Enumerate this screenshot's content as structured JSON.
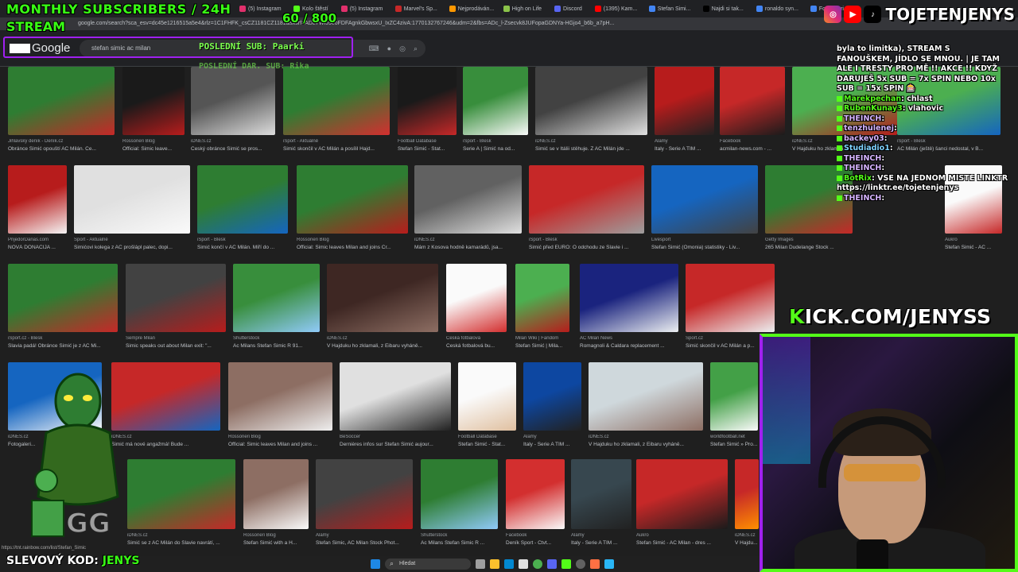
{
  "browser": {
    "tabs": [
      {
        "label": "(5) Instagram",
        "color": "#e1306c"
      },
      {
        "label": "Kolo štěstí",
        "color": "#53fc18"
      },
      {
        "label": "(5) Instagram",
        "color": "#e1306c"
      },
      {
        "label": "Marvel's Sp...",
        "color": "#c62828"
      },
      {
        "label": "Nejprodáván...",
        "color": "#ff9800"
      },
      {
        "label": "High on Life",
        "color": "#8bc34a"
      },
      {
        "label": "Discord",
        "color": "#5865f2"
      },
      {
        "label": "(1395) Kam...",
        "color": "#ff0000"
      },
      {
        "label": "Stefan Simi...",
        "color": "#4285f4"
      },
      {
        "label": "Najdi si tak...",
        "color": "#000000"
      },
      {
        "label": "ronaldo syn...",
        "color": "#4285f4"
      },
      {
        "label": "Fotogaleri...",
        "color": "#4285f4"
      }
    ],
    "url": "google.com/search?sca_esv=dc45e1216515a5e4&rlz=1C1FHFK_csCZ1181CZ1181&sxsrf=ADLYWIJ9eoFDFAgnkGbwsxU_IxZC4zivA:1770132767246&udm=2&fbs=ADc_l-Zsecvk8JUFopaGDNYa-HGjo4_b6b_a7pH..."
  },
  "google": {
    "logo": "Google",
    "query": "stefan simic ac milan"
  },
  "overlay": {
    "title_line1": "MONTHLY SUBSCRIBERS / 24H",
    "title_line2": "STREAM",
    "sub_count": "60  / 800",
    "last_sub": "POSLEDNÍ SUB: Paarki",
    "last_donation": "POSLEDNÍ DAR. SUB: Rika",
    "social_name": "TOJETENJENYS",
    "kick_k": "K",
    "kick_rest": "ICK.COM/JENYSS",
    "discount_label": "SLEVOVÝ KOD: ",
    "discount_code": "JENYS"
  },
  "chat": [
    {
      "kind": "text",
      "text": "byla to limitka), STREAM S FANOUŠKEM, JÍDLO SE MNOU. | JE TAM ALE I TRESTY PRO MĚ !! AKCE !! KDYŽ DARUJEŠ 5x SUB = 7x SPIN NEBO 10x SUB = 15x SPIN 🎰"
    },
    {
      "kind": "msg",
      "user": "Marekpechan",
      "text": ": chlast",
      "ucls": "u"
    },
    {
      "kind": "msg",
      "user": "RubenKunay3",
      "text": ": vlahovic",
      "ucls": "u"
    },
    {
      "kind": "msg",
      "user": "THEINCH",
      "text": ":",
      "ucls": "u2"
    },
    {
      "kind": "msg",
      "user": "tenzhulenej",
      "text": ":",
      "ucls": "u2"
    },
    {
      "kind": "msg",
      "user": "backey03",
      "text": ":",
      "ucls": "u2"
    },
    {
      "kind": "msg",
      "user": "Studiadio1",
      "text": ":",
      "ucls": "u3"
    },
    {
      "kind": "msg",
      "user": "THEINCH",
      "text": ":",
      "ucls": "u2"
    },
    {
      "kind": "msg",
      "user": "THEINCH",
      "text": ":",
      "ucls": "u2"
    },
    {
      "kind": "msg",
      "user": "BotRix",
      "text": ": VŠE NA JEDNOM MÍSTĚ LINKTREE:",
      "ucls": "u"
    },
    {
      "kind": "text",
      "text": "https://linktr.ee/tojetenjenys"
    },
    {
      "kind": "msg",
      "user": "THEINCH",
      "text": ":",
      "ucls": "u2"
    }
  ],
  "results": [
    {
      "title": "Obránce Simić opouští AC Milán. Če...",
      "source": "Jihlavský deník - Deník.cz",
      "c1": "#2e7d32",
      "c2": "#c62828"
    },
    {
      "title": "Official: Simic leave...",
      "source": "Rossoneri Blog",
      "c1": "#1a1a1a",
      "c2": "#b71c1c"
    },
    {
      "title": "Český obránce Simić se pros...",
      "source": "iDNES.cz",
      "c1": "#555",
      "c2": "#ddd"
    },
    {
      "title": "Simić skončil v AC Milán a posílil Hajd...",
      "source": "iSport - Aktuálně",
      "c1": "#2e7d32",
      "c2": "#d32f2f"
    },
    {
      "title": "Stefan Simić - Stat...",
      "source": "Football Database",
      "c1": "#1a1a1a",
      "c2": "#c62828"
    },
    {
      "title": "Serie A | Simić na od...",
      "source": "iSport - Blesk",
      "c1": "#388e3c",
      "c2": "#fafafa"
    },
    {
      "title": "Simić se v Itálii stěhuje. Z AC Milán jde ...",
      "source": "iDNES.cz",
      "c1": "#424242",
      "c2": "#e0e0e0"
    },
    {
      "title": "Italy - Serie A TIM ...",
      "source": "Alamy",
      "c1": "#b71c1c",
      "c2": "#212121"
    },
    {
      "title": "acmilan-news.com - ...",
      "source": "Facebook",
      "c1": "#c62828",
      "c2": "#1b1b1b"
    },
    {
      "title": "V Hajduku ho zklamali, z Eibaru ...",
      "source": "iDNES.cz",
      "c1": "#4caf50",
      "c2": "#b71c1c"
    },
    {
      "title": "AC Milán (ještě) šanci nedostal, v B...",
      "source": "iSport - Blesk",
      "c1": "#4caf50",
      "c2": "#1565c0"
    },
    {
      "title": "NOVÁ DONACIJA ...",
      "source": "PrijedorDanas.com",
      "c1": "#b71c1c",
      "c2": "#f5f5f5"
    },
    {
      "title": "Simićovi kolega z AC prošlápl palec, dopi...",
      "source": "Sport - Aktuálně",
      "c1": "#e0e0e0",
      "c2": "#fafafa"
    },
    {
      "title": "Simić končí v AC Milán. Míří do ...",
      "source": "iSport - Blesk",
      "c1": "#2e7d32",
      "c2": "#1565c0"
    },
    {
      "title": "Official: Simic leaves Milan and joins Cr...",
      "source": "Rossoneri Blog",
      "c1": "#2e7d32",
      "c2": "#b71c1c"
    },
    {
      "title": "Mám z Kosova hodně kamarádů, jsa...",
      "source": "iDNES.cz",
      "c1": "#616161",
      "c2": "#e0e0e0"
    },
    {
      "title": "Simić před EURO: O odchodu ze Slavie i ...",
      "source": "iSport - Blesk",
      "c1": "#c62828",
      "c2": "#9e9e9e"
    },
    {
      "title": "Stefan Simić (Omonia) statistiky - Liv...",
      "source": "Livesport",
      "c1": "#1565c0",
      "c2": "#424242"
    },
    {
      "title": "265 Milan Dudelange Stock ...",
      "source": "Getty Images",
      "c1": "#2e7d32",
      "c2": "#c62828"
    },
    {
      "title": "Stefan Simić - AC ...",
      "source": "Aukro",
      "c1": "#fafafa",
      "c2": "#c62828"
    },
    {
      "title": "Slavia padá! Obránce Simić je z AC Mi...",
      "source": "iSport.cz - Blesk",
      "c1": "#2e7d32",
      "c2": "#c62828"
    },
    {
      "title": "Simic speaks out about Milan exit: \"...",
      "source": "Sempre Milan",
      "c1": "#424242",
      "c2": "#b71c1c"
    },
    {
      "title": "Ac Milans Stefan Simic R 91...",
      "source": "Shutterstock",
      "c1": "#388e3c",
      "c2": "#90caf9"
    },
    {
      "title": "V Hajduku ho zklamali, z Eibaru vyháně...",
      "source": "iDNES.cz",
      "c1": "#3e2723",
      "c2": "#8d6e63"
    },
    {
      "title": "Česká fotbalová bu...",
      "source": "Česká fotbalová",
      "c1": "#fafafa",
      "c2": "#d32f2f"
    },
    {
      "title": "Stefan Simić | Mila...",
      "source": "Milan Wiki | Fandom",
      "c1": "#4caf50",
      "c2": "#b71c1c"
    },
    {
      "title": "Romagnoli & Caldara replacement ...",
      "source": "AC Milan News",
      "c1": "#1a237e",
      "c2": "#eceff1"
    },
    {
      "title": "Simić skončil v AC Milán a p...",
      "source": "Sport.cz",
      "c1": "#c62828",
      "c2": "#eceff1"
    },
    {
      "title": "Fotogaleri...",
      "source": "iDNES.cz",
      "c1": "#1565c0",
      "c2": "#fafafa"
    },
    {
      "title": "Simić má nové angažmá! Bude ...",
      "source": "iDNES.cz",
      "c1": "#c62828",
      "c2": "#1565c0"
    },
    {
      "title": "Official: Simic leaves Milan and joins ...",
      "source": "Rossoneri Blog",
      "c1": "#8d6e63",
      "c2": "#eeeeee"
    },
    {
      "title": "Dernières infos sur Stefan Simić aujour...",
      "source": "BeSoccer",
      "c1": "#e0e0e0",
      "c2": "#212121"
    },
    {
      "title": "Stefan Simić - Stat...",
      "source": "Football Database",
      "c1": "#fafafa",
      "c2": "#e0c0a0"
    },
    {
      "title": "Italy - Serie A TIM ...",
      "source": "Alamy",
      "c1": "#0d47a1",
      "c2": "#212121"
    },
    {
      "title": "V Hajduku ho zklamali, z Eibaru vyháně...",
      "source": "iDNES.cz",
      "c1": "#cfd8dc",
      "c2": "#8d6e63"
    },
    {
      "title": "Stefan Simić » Pro...",
      "source": "worldfootball.net",
      "c1": "#43a047",
      "c2": "#fafafa"
    },
    {
      "title": "Simić se z AC Milán do Slavie navrátí, ...",
      "source": "iDNES.cz",
      "c1": "#2e7d32",
      "c2": "#c62828"
    },
    {
      "title": "Stefan Simić with a H...",
      "source": "Rossoneri Blog",
      "c1": "#8d6e63",
      "c2": "#fafafa"
    },
    {
      "title": "Stefan Simic, AC Milan Stock Phot...",
      "source": "Alamy",
      "c1": "#424242",
      "c2": "#b71c1c"
    },
    {
      "title": "Ac Milans Stefan Simic R ...",
      "source": "Shutterstock",
      "c1": "#2e7d32",
      "c2": "#90caf9"
    },
    {
      "title": "Deník Sport - Čtvt...",
      "source": "Facebook",
      "c1": "#d32f2f",
      "c2": "#fafafa"
    },
    {
      "title": "Italy - Serie A TIM ...",
      "source": "Alamy",
      "c1": "#37474f",
      "c2": "#212121"
    },
    {
      "title": "Stefan Simić - AC Milan - dres ...",
      "source": "Aukro",
      "c1": "#c62828",
      "c2": "#1b1b1b"
    },
    {
      "title": "V Hajdu...",
      "source": "iDNES.cz",
      "c1": "#c62828",
      "c2": "#ff8f00"
    }
  ],
  "taskbar": {
    "search": "Hledat"
  },
  "status_url": "https://tnt.rainbow.com/list/Stefan_Simic"
}
